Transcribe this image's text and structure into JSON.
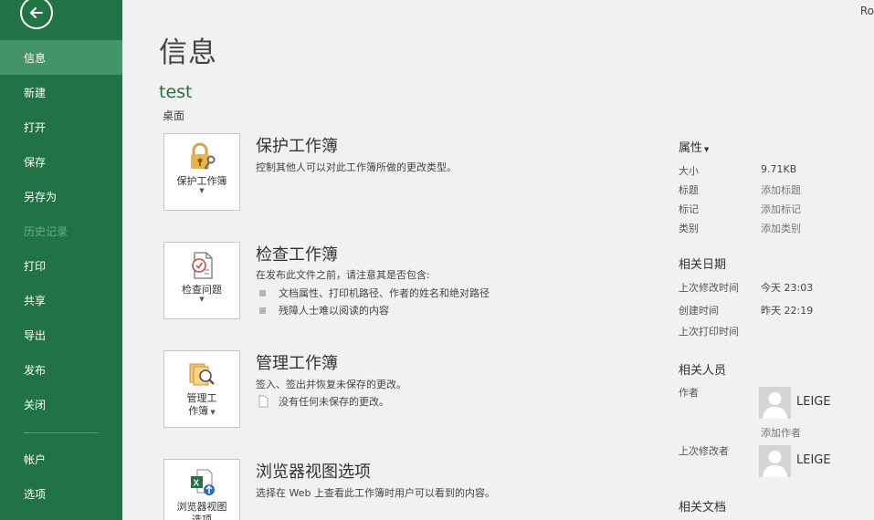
{
  "corner": {
    "user_text": "Ro"
  },
  "sidebar": {
    "back_icon": "back-arrow-icon",
    "items": [
      {
        "label": "信息",
        "active": true
      },
      {
        "label": "新建"
      },
      {
        "label": "打开"
      },
      {
        "label": "保存"
      },
      {
        "label": "另存为"
      },
      {
        "label": "历史记录",
        "disabled": true
      },
      {
        "label": "打印"
      },
      {
        "label": "共享"
      },
      {
        "label": "导出"
      },
      {
        "label": "发布"
      },
      {
        "label": "关闭"
      },
      {
        "label": "帐户"
      },
      {
        "label": "选项"
      }
    ]
  },
  "main": {
    "title": "信息",
    "doc_name": "test",
    "doc_location": "桌面",
    "sections": [
      {
        "tile_label": "保护工作簿",
        "title": "保护工作簿",
        "desc": "控制其他人可以对此工作簿所做的更改类型。"
      },
      {
        "tile_label": "检查问题",
        "title": "检查工作簿",
        "desc": "在发布此文件之前，请注意其是否包含:",
        "bullets": [
          "文档属性、打印机路径、作者的姓名和绝对路径",
          "残障人士难以阅读的内容"
        ]
      },
      {
        "tile_label_line1": "管理工",
        "tile_label_line2": "作簿",
        "title": "管理工作簿",
        "desc": "签入、签出并恢复未保存的更改。",
        "note": "没有任何未保存的更改。"
      },
      {
        "tile_label_line1": "浏览器视图",
        "tile_label_line2": "选项",
        "title": "浏览器视图选项",
        "desc": "选择在 Web 上查看此工作簿时用户可以看到的内容。"
      }
    ]
  },
  "properties": {
    "heading": "属性",
    "size_label": "大小",
    "size_value": "9.71KB",
    "title_label": "标题",
    "title_value": "添加标题",
    "tags_label": "标记",
    "tags_value": "添加标记",
    "category_label": "类别",
    "category_value": "添加类别",
    "dates_heading": "相关日期",
    "modified_label": "上次修改时间",
    "modified_value": "今天 23:03",
    "created_label": "创建时间",
    "created_value": "昨天 22:19",
    "printed_label": "上次打印时间",
    "people_heading": "相关人员",
    "author_label": "作者",
    "author_name": "LEIGE",
    "add_author": "添加作者",
    "modified_by_label": "上次修改者",
    "modified_by_name": "LEIGE",
    "docs_heading": "相关文档"
  },
  "colors": {
    "accent": "#217346",
    "sidebar_active": "#439467"
  }
}
